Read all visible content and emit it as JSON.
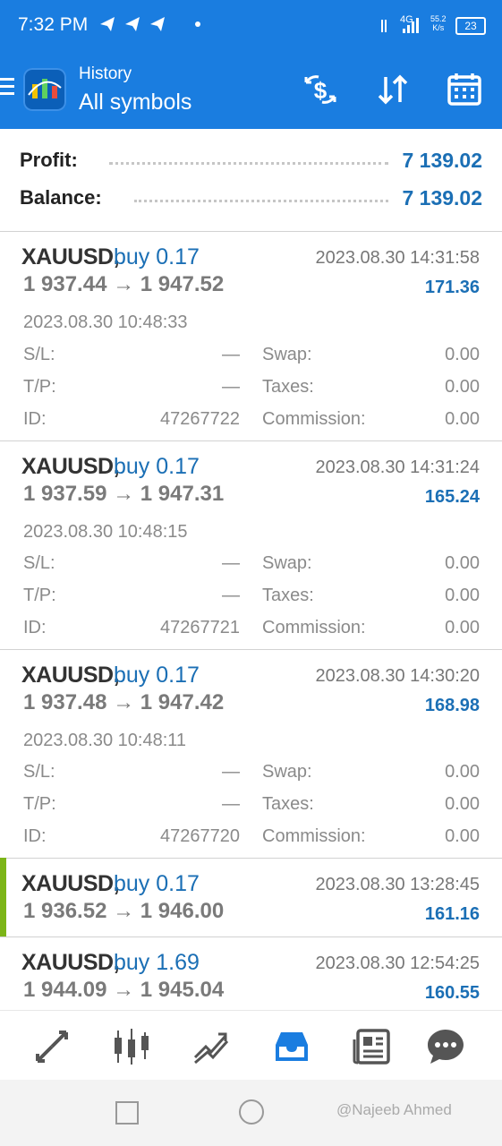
{
  "status_bar": {
    "time": "7:32 PM",
    "network": "4G",
    "speed_value": "55.2",
    "speed_unit": "K/s",
    "battery": "23"
  },
  "header": {
    "subtitle": "History",
    "title": "All symbols",
    "icons": [
      "menu-icon",
      "app-logo",
      "money-exchange-icon",
      "sort-icon",
      "calendar-icon"
    ]
  },
  "summary": {
    "profit_label": "Profit:",
    "profit_value": "7 139.02",
    "balance_label": "Balance:",
    "balance_value": "7 139.02"
  },
  "labels": {
    "sl": "S/L:",
    "tp": "T/P:",
    "id": "ID:",
    "swap": "Swap:",
    "taxes": "Taxes:",
    "commission": "Commission:"
  },
  "deals": [
    {
      "symbol": "XAUUSD,",
      "type": "buy 0.17",
      "close_time": "2023.08.30 14:31:58",
      "prices": "1 937.44 → 1 947.52",
      "profit": "171.36",
      "open_time": "2023.08.30 10:48:33",
      "sl": "—",
      "tp": "—",
      "id": "47267722",
      "swap": "0.00",
      "taxes": "0.00",
      "commission": "0.00"
    },
    {
      "symbol": "XAUUSD,",
      "type": "buy 0.17",
      "close_time": "2023.08.30 14:31:24",
      "prices": "1 937.59 → 1 947.31",
      "profit": "165.24",
      "open_time": "2023.08.30 10:48:15",
      "sl": "—",
      "tp": "—",
      "id": "47267721",
      "swap": "0.00",
      "taxes": "0.00",
      "commission": "0.00"
    },
    {
      "symbol": "XAUUSD,",
      "type": "buy 0.17",
      "close_time": "2023.08.30 14:30:20",
      "prices": "1 937.48 → 1 947.42",
      "profit": "168.98",
      "open_time": "2023.08.30 10:48:11",
      "sl": "—",
      "tp": "—",
      "id": "47267720",
      "swap": "0.00",
      "taxes": "0.00",
      "commission": "0.00"
    },
    {
      "symbol": "XAUUSD,",
      "type": "buy 0.17",
      "close_time": "2023.08.30 13:28:45",
      "prices": "1 936.52 → 1 946.00",
      "profit": "161.16"
    },
    {
      "symbol": "XAUUSD,",
      "type": "buy 1.69",
      "close_time": "2023.08.30 12:54:25",
      "prices": "1 944.09 → 1 945.04",
      "profit": "160.55"
    }
  ],
  "bottom_nav": [
    "quotes-icon",
    "chart-icon",
    "trade-icon",
    "history-icon",
    "news-icon",
    "chat-icon"
  ],
  "bottom_nav_active": "history-icon",
  "watermark": "@Najeeb Ahmed",
  "colors": {
    "brand": "#1a7de0",
    "profit": "#1b6fb5",
    "selected_bar": "#7cb518"
  }
}
